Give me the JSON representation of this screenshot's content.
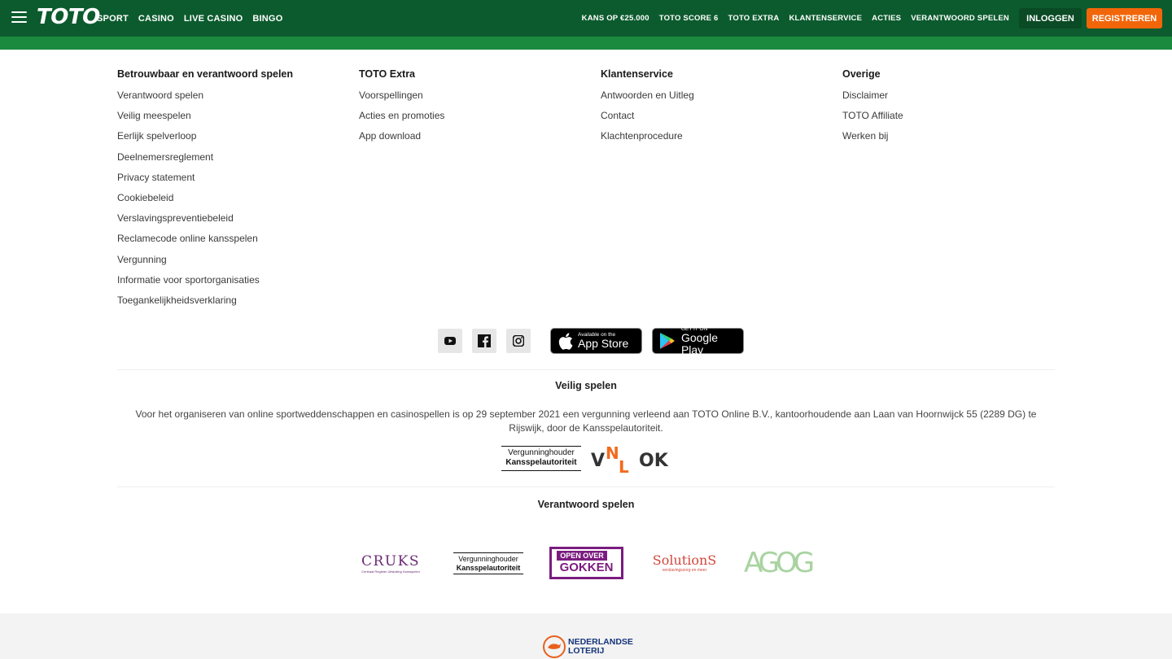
{
  "header": {
    "logo_text": "TOTO",
    "main_nav": [
      "SPORT",
      "CASINO",
      "LIVE CASINO",
      "BINGO"
    ],
    "right_nav": [
      "KANS OP €25.000",
      "TOTO SCORE 6",
      "TOTO EXTRA",
      "KLANTENSERVICE",
      "ACTIES",
      "VERANTWOORD SPELEN"
    ],
    "login_label": "INLOGGEN",
    "register_label": "REGISTREREN"
  },
  "footer": {
    "columns": [
      {
        "title": "Betrouwbaar en verantwoord spelen",
        "links": [
          "Verantwoord spelen",
          "Veilig meespelen",
          "Eerlijk spelverloop",
          "Deelnemersreglement",
          "Privacy statement",
          "Cookiebeleid",
          "Verslavingspreventiebeleid",
          "Reclamecode online kansspelen",
          "Vergunning",
          "Informatie voor sportorganisaties",
          "Toegankelijkheidsverklaring"
        ]
      },
      {
        "title": "TOTO Extra",
        "links": [
          "Voorspellingen",
          "Acties en promoties",
          "App download"
        ]
      },
      {
        "title": "Klantenservice",
        "links": [
          "Antwoorden en Uitleg",
          "Contact",
          "Klachtenprocedure"
        ]
      },
      {
        "title": "Overige",
        "links": [
          "Disclaimer",
          "TOTO Affiliate",
          "Werken bij"
        ]
      }
    ],
    "app_store": {
      "small": "Available on the",
      "big": "App Store"
    },
    "google_play": {
      "small": "GET IT ON",
      "big": "Google Play"
    },
    "safe_play_title": "Veilig spelen",
    "license_text": "Voor het organiseren van online sportweddenschappen en casinospellen is op 29 september 2021 een vergunning verleend aan TOTO Online B.V., kantoorhoudende aan Laan van Hoornwijck 55 (2289 DG) te Rijswijk, door de Kansspelautoriteit.",
    "ksa_line1": "Vergunninghouder",
    "ksa_line2": "Kansspelautoriteit",
    "responsible_title": "Verantwoord spelen",
    "partner_logos": {
      "cruks": "CRUKS",
      "cruks_sub": "Centraal Register Uitsluiting Kansspelen",
      "open_over": "OPEN OVER",
      "gokken": "GOKKEN",
      "solutions": "SolutionS",
      "solutions_sub": "verslavingszorg en meer",
      "agog": "AGOG"
    },
    "loterij_line1": "NEDERLANDSE",
    "loterij_line2": "LOTERIJ"
  },
  "colors": {
    "header_bg": "#0c5b2e",
    "subbar": "#1b8a3f",
    "register": "#f2660a",
    "login": "#0a4a25"
  }
}
